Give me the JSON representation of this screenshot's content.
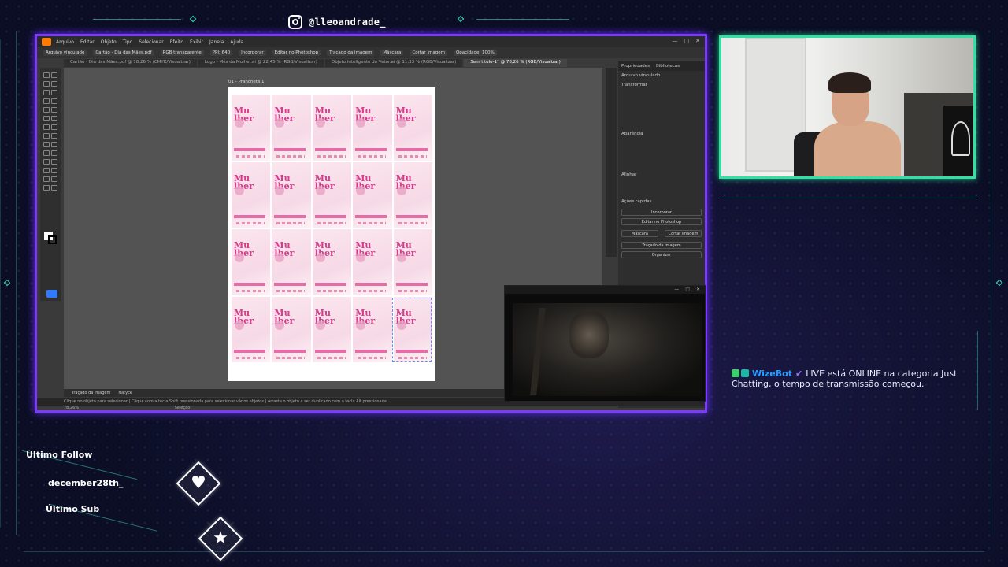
{
  "social": {
    "handle": "@lleoandrade_",
    "icon": "instagram-icon"
  },
  "illustrator": {
    "menu": [
      "Arquivo",
      "Editar",
      "Objeto",
      "Tipo",
      "Selecionar",
      "Efeito",
      "Exibir",
      "Janela",
      "Ajuda"
    ],
    "control_bar": [
      "Arquivo vinculado",
      "Cartão - Dia das Mães.pdf",
      "RGB transparente",
      "PPI: 640",
      "Incorporar",
      "Editar no Photoshop",
      "Traçado da imagem",
      "Máscara",
      "Cortar imagem",
      "Opacidade: 100%"
    ],
    "tabs": [
      {
        "label": "Cartão - Dia das Mães.pdf @ 78,26 % (CMYK/Visualizar)",
        "active": false
      },
      {
        "label": "Logo - Mês da Mulher.ai @ 22,45 % (RGB/Visualizar)",
        "active": false
      },
      {
        "label": "Objeto inteligente do Vetor.ai @ 11,33 % (RGB/Visualizar)",
        "active": false
      },
      {
        "label": "Sem título-1* @ 78,26 % (RGB/Visualizar)",
        "active": true
      }
    ],
    "artboard_label": "01 - Prancheta 1",
    "tile_title": "Mu lher",
    "properties": {
      "tabs": [
        "Propriedades",
        "Bibliotecas"
      ],
      "selection": "Arquivo vinculado",
      "transform_label": "Transformar",
      "appearance_label": "Aparência",
      "align_label": "Alinhar",
      "quick_actions_label": "Ações rápidas",
      "buttons": [
        "Incorporar",
        "Editar no Photoshop",
        "Máscara",
        "Cortar imagem",
        "Traçado da imagem",
        "Organizar"
      ]
    },
    "bottom_bar": [
      "Traçado da imagem",
      "Natyce"
    ],
    "status": "Clique no objeto para selecionar | Clique com a tecla Shift pressionada para selecionar vários objetos | Arraste o objeto a ser duplicado com a tecla Alt pressionada",
    "zoom": "78,26%",
    "status_tool": "Seleção"
  },
  "chat": {
    "user": "WizeBot",
    "message": "LIVE está ONLINE na categoria Just Chatting, o tempo de transmissão começou."
  },
  "alerts": {
    "follow_label": "Último Follow",
    "follow_name": "december28th_",
    "sub_label": "Último Sub",
    "follow_icon": "heart-icon",
    "sub_icon": "star-icon"
  },
  "colors": {
    "accent_purple": "#7b3bff",
    "accent_green": "#34e0a1",
    "frame_cyan": "#3fe0c8"
  }
}
